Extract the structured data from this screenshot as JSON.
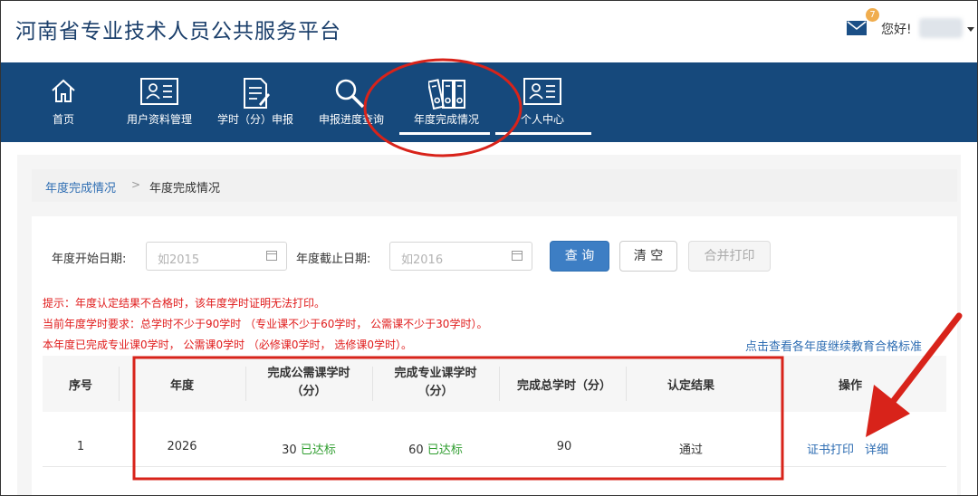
{
  "header": {
    "site_title": "河南省专业技术人员公共服务平台",
    "notification_count": "7",
    "greeting": "您好!"
  },
  "nav": {
    "items": [
      {
        "label": "首页",
        "icon": "home-icon"
      },
      {
        "label": "用户资料管理",
        "icon": "id-card-icon"
      },
      {
        "label": "学时（分）申报",
        "icon": "document-icon"
      },
      {
        "label": "申报进度查询",
        "icon": "search-icon"
      },
      {
        "label": "年度完成情况",
        "icon": "binders-icon",
        "active": true
      },
      {
        "label": "个人中心",
        "icon": "profile-card-icon"
      }
    ]
  },
  "breadcrumb": {
    "parent": "年度完成情况",
    "separator": ">",
    "current": "年度完成情况"
  },
  "filters": {
    "start_label": "年度开始日期:",
    "start_placeholder": "如2015",
    "end_label": "年度截止日期:",
    "end_placeholder": "如2016",
    "query_button": "查 询",
    "clear_button": "清 空",
    "merge_print_button": "合并打印"
  },
  "notices": [
    "提示：年度认定结果不合格时，该年度学时证明无法打印。",
    "当前年度学时要求：总学时不少于90学时 （专业课不少于60学时， 公需课不少于30学时）。",
    "本年度已完成专业课0学时， 公需课0学时 （必修课0学时， 选修课0学时）。"
  ],
  "standards_link": "点击查看各年度继续教育合格标准",
  "table": {
    "headers": [
      "序号",
      "年度",
      "完成公需课学时（分）",
      "完成专业课学时（分）",
      "完成总学时（分）",
      "认定结果",
      "操作"
    ],
    "rows": [
      {
        "index": "1",
        "year": "2026",
        "public_hours": "30",
        "public_status": "已达标",
        "professional_hours": "60",
        "professional_status": "已达标",
        "total_hours": "90",
        "result": "通过",
        "actions": [
          "证书打印",
          "详细"
        ]
      }
    ]
  },
  "colors": {
    "nav_bg": "#16497c",
    "title": "#1b3f6b",
    "link": "#2f6eb3",
    "notice": "#e01b1b",
    "ok": "#2e9d2e",
    "annotation": "#d8231a"
  }
}
